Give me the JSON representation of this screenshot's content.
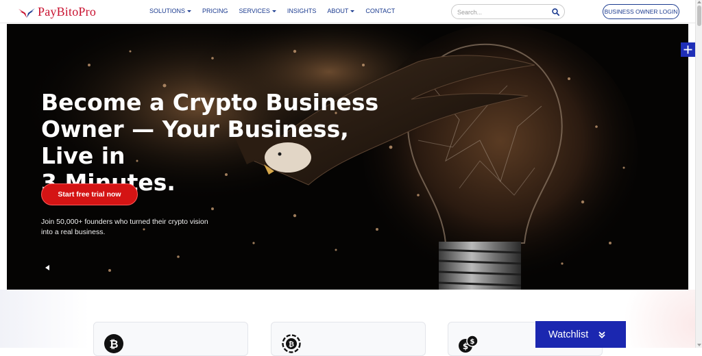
{
  "header": {
    "logo_text": "PayBitoPro",
    "nav": [
      {
        "label": "SOLUTIONS",
        "dropdown": true
      },
      {
        "label": "PRICING",
        "dropdown": false
      },
      {
        "label": "SERVICES",
        "dropdown": true
      },
      {
        "label": "INSIGHTS",
        "dropdown": false
      },
      {
        "label": "ABOUT",
        "dropdown": true
      },
      {
        "label": "CONTACT",
        "dropdown": false
      }
    ],
    "search_placeholder": "Search...",
    "login_label": "BUSINESS OWNER LOGIN"
  },
  "hero": {
    "title_lines": [
      "Become a Crypto Business",
      "Owner — Your Business, Live in",
      "3 Minutes."
    ],
    "cta_label": "Start free trial now",
    "subtitle_lines": [
      "Join 50,000+ founders who turned their crypto vision",
      "into a real business."
    ]
  },
  "cards": [
    {
      "icon": "bitcoin-icon"
    },
    {
      "icon": "bitcoin-cycle-icon"
    },
    {
      "icon": "dollar-coins-icon"
    }
  ],
  "watchlist": {
    "label": "Watchlist"
  },
  "colors": {
    "brand_red": "#c8102e",
    "nav_blue": "#1a3a8f",
    "cta_red": "#d41414",
    "watchlist_blue": "#1b27b0"
  }
}
